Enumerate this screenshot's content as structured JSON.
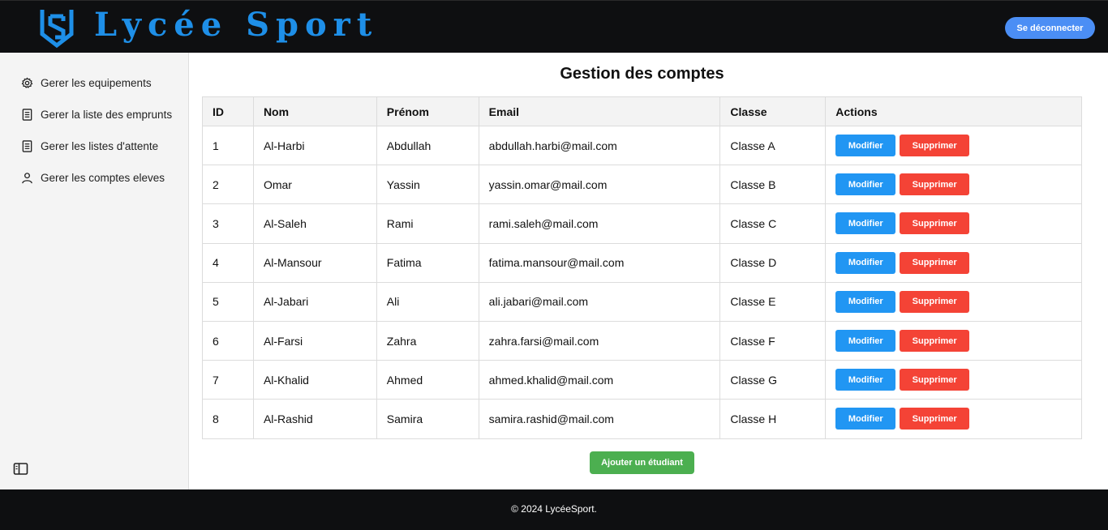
{
  "header": {
    "brand": "Lycée Sport",
    "logout_label": "Se déconnecter",
    "brand_color": "#1e8fe8",
    "logout_color": "#4b8ef5"
  },
  "sidebar": {
    "items": [
      {
        "label": "Gerer les equipements",
        "icon": "gear-icon"
      },
      {
        "label": "Gerer la liste des emprunts",
        "icon": "list-document-icon"
      },
      {
        "label": "Gerer les listes d'attente",
        "icon": "list-document-icon"
      },
      {
        "label": "Gerer les comptes eleves",
        "icon": "user-icon"
      }
    ],
    "toggle_icon": "sidebar-toggle-icon"
  },
  "main": {
    "title": "Gestion des comptes",
    "columns": [
      "ID",
      "Nom",
      "Prénom",
      "Email",
      "Classe",
      "Actions"
    ],
    "edit_label": "Modifier",
    "delete_label": "Supprimer",
    "rows": [
      {
        "id": "1",
        "nom": "Al-Harbi",
        "prenom": "Abdullah",
        "email": "abdullah.harbi@mail.com",
        "classe": "Classe A"
      },
      {
        "id": "2",
        "nom": "Omar",
        "prenom": "Yassin",
        "email": "yassin.omar@mail.com",
        "classe": "Classe B"
      },
      {
        "id": "3",
        "nom": "Al-Saleh",
        "prenom": "Rami",
        "email": "rami.saleh@mail.com",
        "classe": "Classe C"
      },
      {
        "id": "4",
        "nom": "Al-Mansour",
        "prenom": "Fatima",
        "email": "fatima.mansour@mail.com",
        "classe": "Classe D"
      },
      {
        "id": "5",
        "nom": "Al-Jabari",
        "prenom": "Ali",
        "email": "ali.jabari@mail.com",
        "classe": "Classe E"
      },
      {
        "id": "6",
        "nom": "Al-Farsi",
        "prenom": "Zahra",
        "email": "zahra.farsi@mail.com",
        "classe": "Classe F"
      },
      {
        "id": "7",
        "nom": "Al-Khalid",
        "prenom": "Ahmed",
        "email": "ahmed.khalid@mail.com",
        "classe": "Classe G"
      },
      {
        "id": "8",
        "nom": "Al-Rashid",
        "prenom": "Samira",
        "email": "samira.rashid@mail.com",
        "classe": "Classe H"
      }
    ],
    "add_label": "Ajouter un étudiant",
    "colors": {
      "edit": "#2196f3",
      "delete": "#f44336",
      "add": "#4caf50"
    }
  },
  "footer": {
    "text": "© 2024 LycéeSport."
  }
}
